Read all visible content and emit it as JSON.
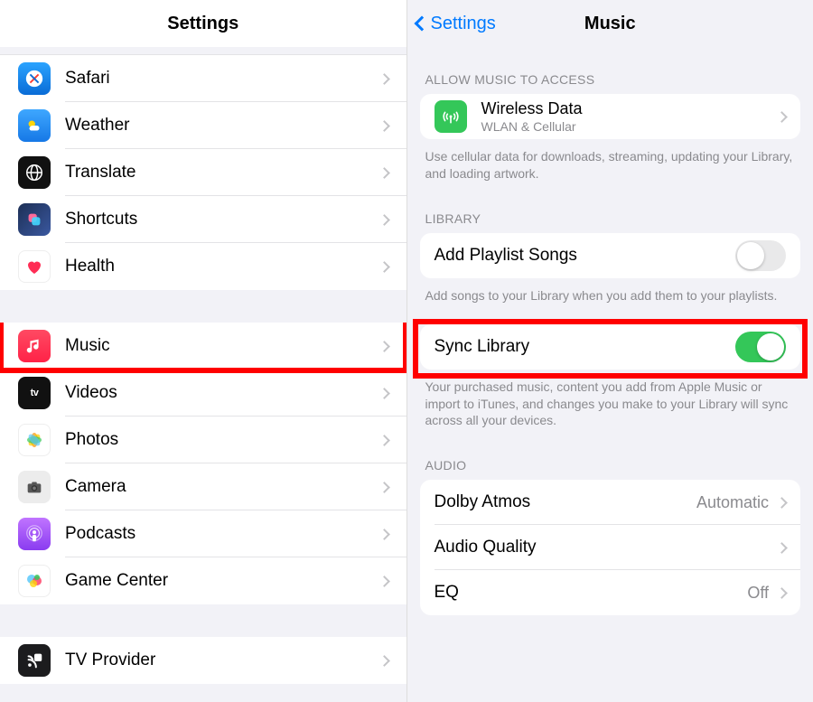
{
  "left": {
    "title": "Settings",
    "groups": [
      {
        "items": [
          {
            "label": "Safari",
            "icon": "safari-icon"
          },
          {
            "label": "Weather",
            "icon": "weather-icon"
          },
          {
            "label": "Translate",
            "icon": "translate-icon"
          },
          {
            "label": "Shortcuts",
            "icon": "shortcuts-icon"
          },
          {
            "label": "Health",
            "icon": "health-icon"
          }
        ]
      },
      {
        "items": [
          {
            "label": "Music",
            "icon": "music-icon",
            "highlighted": true
          },
          {
            "label": "Videos",
            "icon": "videos-icon"
          },
          {
            "label": "Photos",
            "icon": "photos-icon"
          },
          {
            "label": "Camera",
            "icon": "camera-icon"
          },
          {
            "label": "Podcasts",
            "icon": "podcasts-icon"
          },
          {
            "label": "Game Center",
            "icon": "gamecenter-icon"
          }
        ]
      },
      {
        "items": [
          {
            "label": "TV Provider",
            "icon": "tvprovider-icon"
          }
        ]
      }
    ]
  },
  "right": {
    "back_label": "Settings",
    "title": "Music",
    "sections": {
      "access": {
        "header": "ALLOW MUSIC TO ACCESS",
        "wireless_label": "Wireless Data",
        "wireless_sub": "WLAN & Cellular",
        "footer": "Use cellular data for downloads, streaming, updating your Library, and loading artwork."
      },
      "library": {
        "header": "LIBRARY",
        "add_playlist_label": "Add Playlist Songs",
        "add_playlist_on": false,
        "add_playlist_footer": "Add songs to your Library when you add them to your playlists.",
        "sync_label": "Sync Library",
        "sync_on": true,
        "sync_highlighted": true,
        "sync_footer": "Your purchased music, content you add from Apple Music or import to iTunes, and changes you make to your Library will sync across all your devices."
      },
      "audio": {
        "header": "AUDIO",
        "items": [
          {
            "label": "Dolby Atmos",
            "value": "Automatic"
          },
          {
            "label": "Audio Quality",
            "value": ""
          },
          {
            "label": "EQ",
            "value": "Off"
          }
        ]
      }
    }
  }
}
